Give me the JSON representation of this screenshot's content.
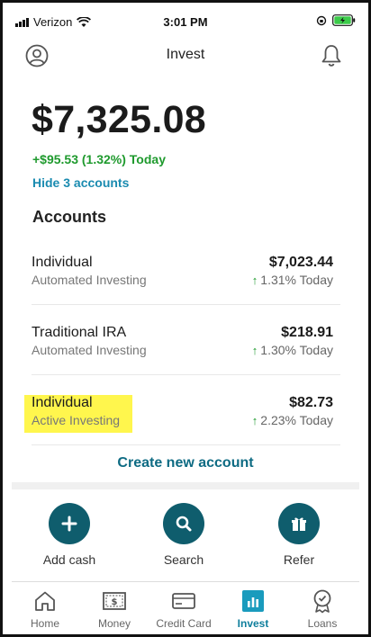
{
  "status_bar": {
    "carrier": "Verizon",
    "time": "3:01 PM"
  },
  "header": {
    "title": "Invest"
  },
  "summary": {
    "balance": "$7,325.08",
    "change_today": "+$95.53 (1.32%) Today",
    "hide_link": "Hide 3 accounts",
    "accounts_heading": "Accounts"
  },
  "accounts": [
    {
      "name": "Individual",
      "type": "Automated Investing",
      "value": "$7,023.44",
      "change": "1.31% Today"
    },
    {
      "name": "Traditional IRA",
      "type": "Automated Investing",
      "value": "$218.91",
      "change": "1.30% Today"
    },
    {
      "name": "Individual",
      "type": "Active Investing",
      "value": "$82.73",
      "change": "2.23% Today"
    }
  ],
  "create_account": "Create new account",
  "actions": [
    {
      "label": "Add cash",
      "icon": "plus-icon"
    },
    {
      "label": "Search",
      "icon": "search-icon"
    },
    {
      "label": "Refer",
      "icon": "gift-icon"
    }
  ],
  "tabs": [
    {
      "label": "Home",
      "icon": "home-icon"
    },
    {
      "label": "Money",
      "icon": "money-icon"
    },
    {
      "label": "Credit Card",
      "icon": "credit-card-icon"
    },
    {
      "label": "Invest",
      "icon": "invest-icon",
      "active": true
    },
    {
      "label": "Loans",
      "icon": "loans-icon"
    }
  ],
  "colors": {
    "positive": "#1f9a2e",
    "link": "#1a8bb0",
    "action_button": "#0f5d6d",
    "active_tab": "#0e7e9c",
    "highlight": "#fff64d"
  }
}
